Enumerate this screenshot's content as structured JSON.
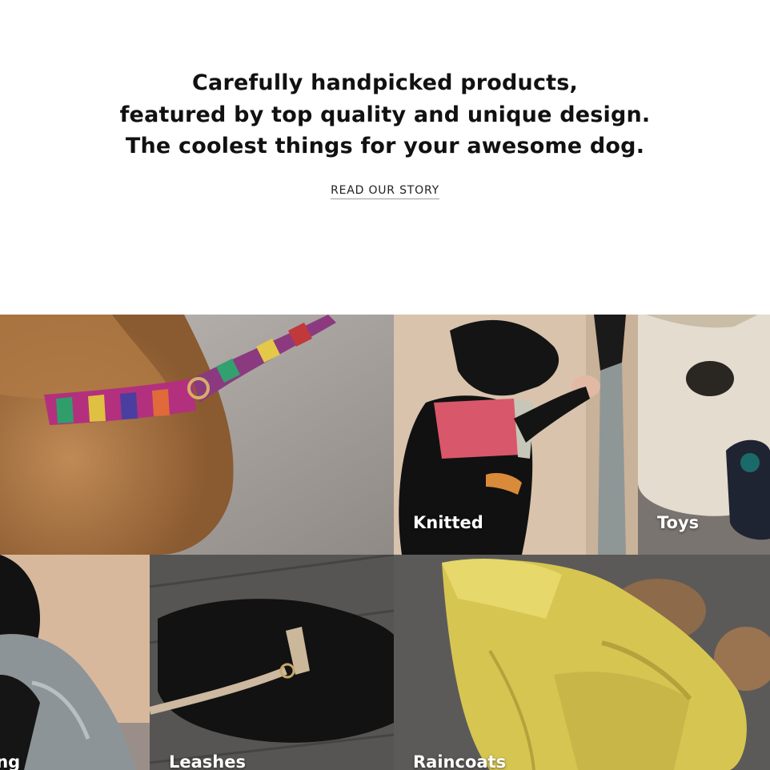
{
  "hero": {
    "headline_lines": [
      "Carefully handpicked products,",
      "featured by top quality and unique design.",
      "The coolest things for your awesome dog."
    ],
    "read_story_label": "READ OUR STORY"
  },
  "categories": [
    {
      "label": ""
    },
    {
      "label": "Knitted"
    },
    {
      "label": "Toys"
    },
    {
      "label": "ing"
    },
    {
      "label": "Leashes"
    },
    {
      "label": "Raincoats"
    }
  ],
  "colors": {
    "text": "#111111",
    "background": "#ffffff",
    "label": "#ffffff"
  }
}
